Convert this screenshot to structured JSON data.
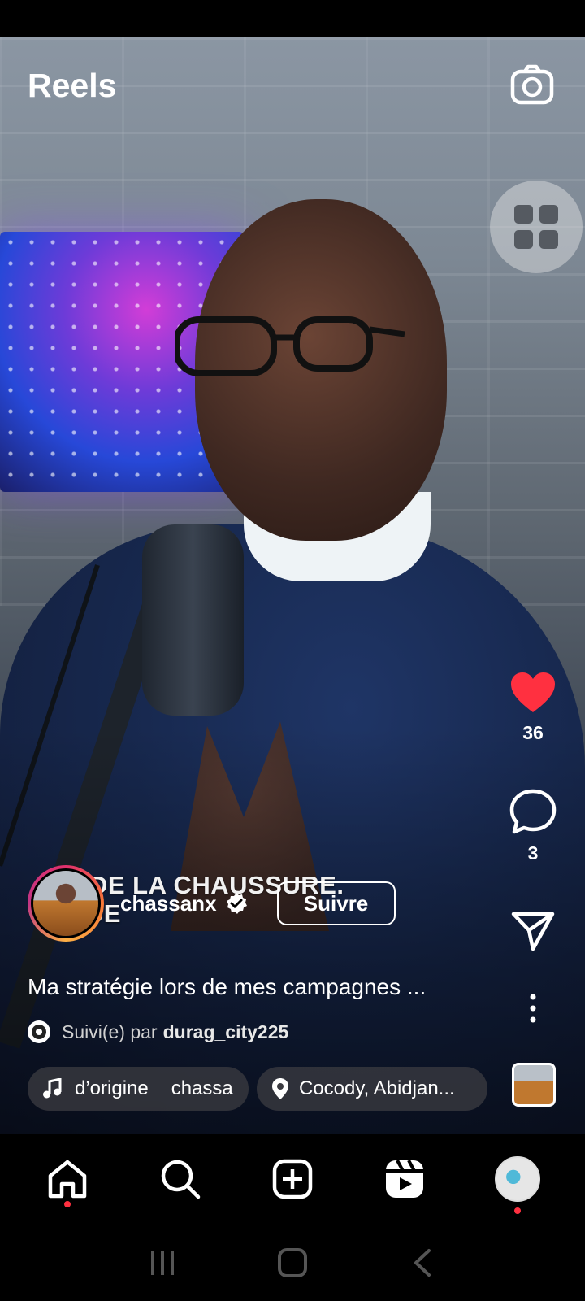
{
  "header": {
    "title": "Reels",
    "camera_icon": "camera-icon",
    "grid_icon": "grid-icon"
  },
  "video": {
    "burned_caption_line1": "DE LA CHAUSSURE.",
    "burned_caption_line2": "JE"
  },
  "actions": {
    "like_count": "36",
    "comment_count": "3",
    "like_color": "#ff3040"
  },
  "author": {
    "username": "chassanx",
    "follow_label": "Suivre"
  },
  "post": {
    "description": "Ma stratégie lors de mes campagnes ...",
    "followed_by_prefix": "Suivi(e) par",
    "followed_by_user": "durag_city225"
  },
  "audio": {
    "part1": "d’origine",
    "part2": "chassa"
  },
  "location": {
    "label": "Cocody, Abidjan..."
  },
  "nav": {
    "items": [
      "home-icon",
      "search-icon",
      "create-icon",
      "reels-icon",
      "profile-avatar"
    ],
    "accent": "#ff3040"
  },
  "system_nav": [
    "recents-icon",
    "home-button-icon",
    "back-icon"
  ]
}
